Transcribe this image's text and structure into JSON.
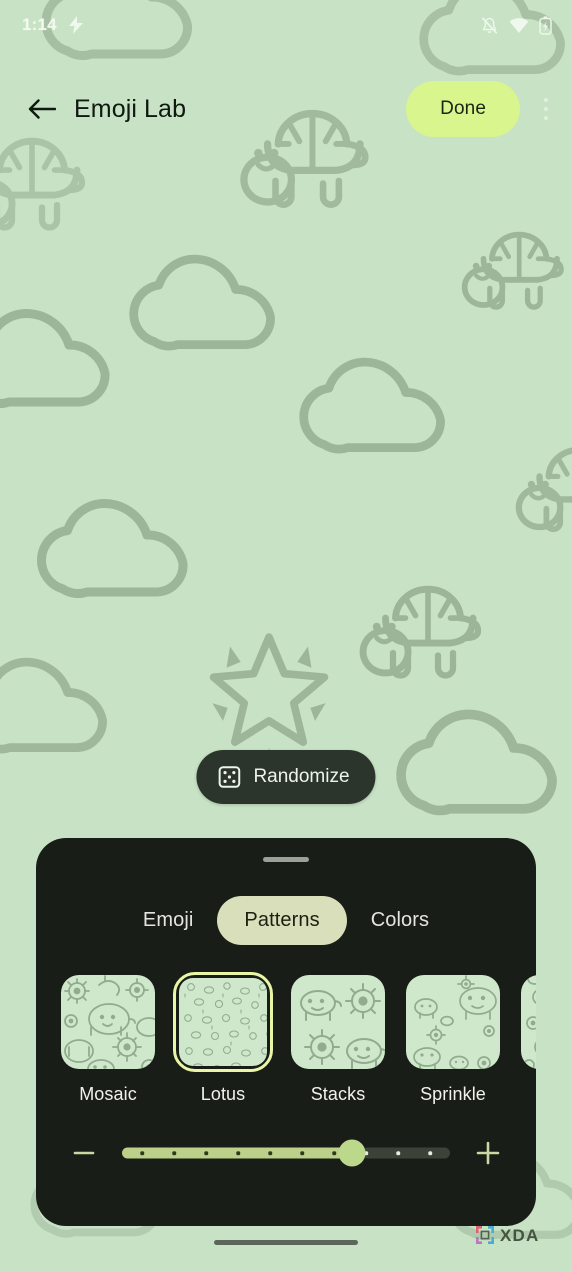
{
  "status_bar": {
    "time": "1:14",
    "icons": [
      "charging-bolt-icon",
      "notifications-off-icon",
      "wifi-icon",
      "battery-icon"
    ]
  },
  "top_bar": {
    "back_icon": "arrow-back-icon",
    "title": "Emoji Lab",
    "done_label": "Done",
    "overflow_icon": "more-vert-icon"
  },
  "canvas": {
    "randomize_label": "Randomize",
    "randomize_icon": "dice-icon",
    "wallpaper_emoji": [
      "turtle",
      "cloud",
      "star"
    ]
  },
  "bottom_sheet": {
    "handle": "drag-handle",
    "tabs": [
      {
        "label": "Emoji",
        "active": false
      },
      {
        "label": "Patterns",
        "active": true
      },
      {
        "label": "Colors",
        "active": false
      }
    ],
    "patterns": [
      {
        "label": "Mosaic",
        "selected": false,
        "style": "mosaic"
      },
      {
        "label": "Lotus",
        "selected": true,
        "style": "lotus"
      },
      {
        "label": "Stacks",
        "selected": false,
        "style": "stacks"
      },
      {
        "label": "Sprinkle",
        "selected": false,
        "style": "sprinkle"
      },
      {
        "label": "",
        "selected": false,
        "style": "scatter"
      }
    ],
    "size_slider": {
      "minus_icon": "minus-icon",
      "plus_icon": "plus-icon",
      "value": 70,
      "min": 0,
      "max": 100,
      "ticks_total": 10,
      "ticks_filled": 7
    }
  },
  "nav_bar": {
    "gesture_pill": "home-gesture-pill"
  },
  "watermark": {
    "text": "XDA"
  },
  "colors": {
    "wallpaper_bg": "#c7e2c4",
    "wallpaper_stroke": "#93ac90",
    "done_button": "#d9f58e",
    "sheet_bg": "#191d17",
    "active_tab": "#d9debb",
    "selected_ring": "#e9f6a8",
    "slider_fill": "#bcd08a",
    "slider_thumb": "#bcd88a",
    "thumb_bg": "#cfe8cb",
    "randomize_bg": "#2c352b"
  }
}
